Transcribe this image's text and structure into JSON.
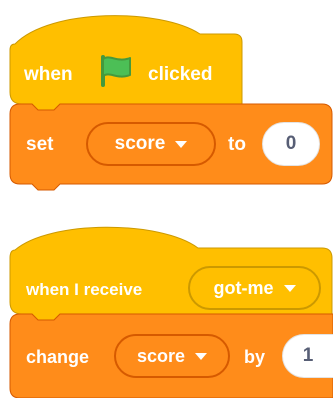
{
  "colors": {
    "events": "#ffbf00",
    "events_border": "#cc9900",
    "variables": "#ff8c1a",
    "variables_border": "#d65a00",
    "flag": "#4cbf56"
  },
  "script1": {
    "hat": {
      "word_when": "when",
      "icon": "green-flag-icon",
      "word_clicked": "clicked"
    },
    "set_block": {
      "word_set": "set",
      "variable": "score",
      "word_to": "to",
      "value": "0"
    }
  },
  "script2": {
    "hat": {
      "word_when_receive": "when I receive",
      "message": "got-me"
    },
    "change_block": {
      "word_change": "change",
      "variable": "score",
      "word_by": "by",
      "value": "1"
    }
  }
}
